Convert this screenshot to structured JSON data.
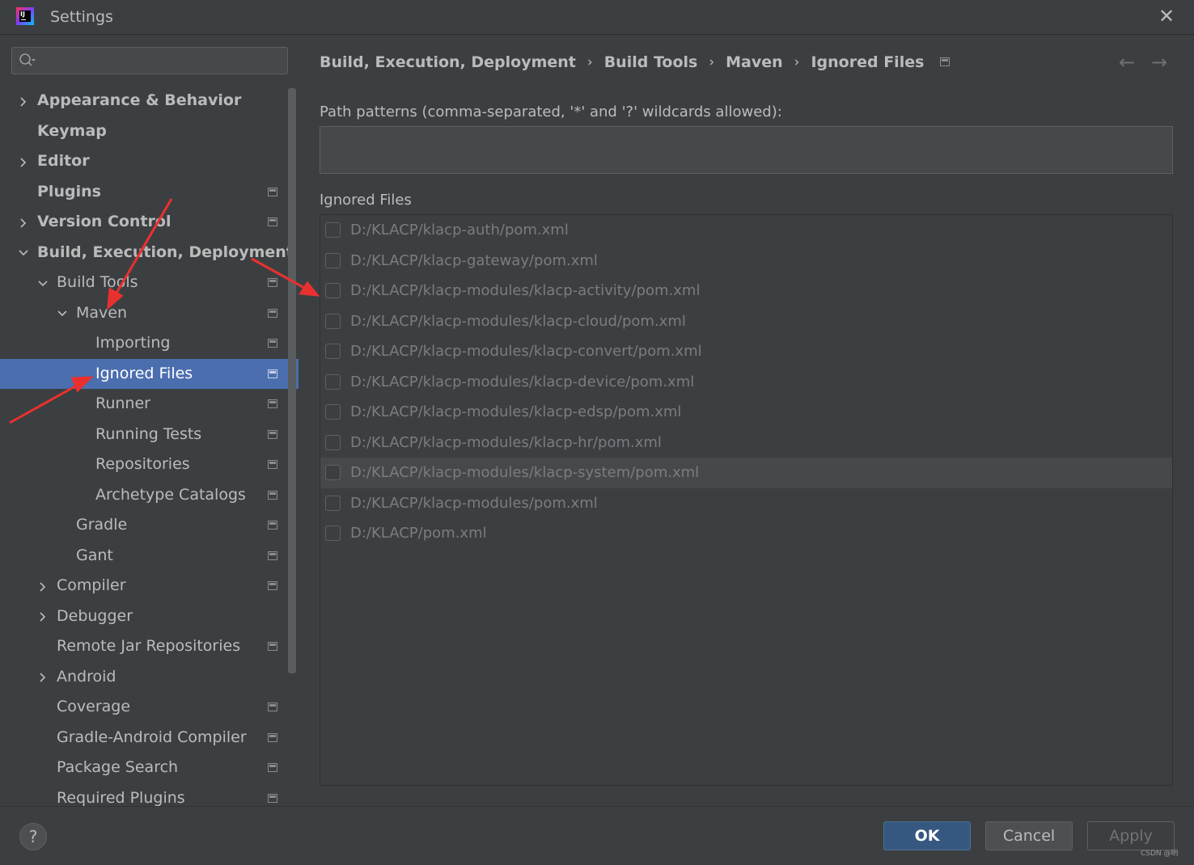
{
  "window": {
    "title": "Settings",
    "close_glyph": "✕",
    "app_icon": "intellij-logo",
    "app_icon_text": "IJ"
  },
  "search": {
    "placeholder": "",
    "value": "",
    "icon": "search-icon"
  },
  "tree": [
    {
      "label": "Appearance & Behavior",
      "level": 0,
      "bold": true,
      "expand": "collapsed",
      "project": false
    },
    {
      "label": "Keymap",
      "level": 0,
      "bold": true,
      "expand": "none",
      "project": false
    },
    {
      "label": "Editor",
      "level": 0,
      "bold": true,
      "expand": "collapsed",
      "project": false
    },
    {
      "label": "Plugins",
      "level": 0,
      "bold": true,
      "expand": "none",
      "project": true
    },
    {
      "label": "Version Control",
      "level": 0,
      "bold": true,
      "expand": "collapsed",
      "project": true
    },
    {
      "label": "Build, Execution, Deployment",
      "level": 0,
      "bold": true,
      "expand": "expanded",
      "project": false
    },
    {
      "label": "Build Tools",
      "level": 1,
      "bold": false,
      "expand": "expanded",
      "project": true
    },
    {
      "label": "Maven",
      "level": 2,
      "bold": false,
      "expand": "expanded",
      "project": true
    },
    {
      "label": "Importing",
      "level": 3,
      "bold": false,
      "expand": "none",
      "project": true
    },
    {
      "label": "Ignored Files",
      "level": 3,
      "bold": false,
      "expand": "none",
      "project": true,
      "selected": true
    },
    {
      "label": "Runner",
      "level": 3,
      "bold": false,
      "expand": "none",
      "project": true
    },
    {
      "label": "Running Tests",
      "level": 3,
      "bold": false,
      "expand": "none",
      "project": true
    },
    {
      "label": "Repositories",
      "level": 3,
      "bold": false,
      "expand": "none",
      "project": true
    },
    {
      "label": "Archetype Catalogs",
      "level": 3,
      "bold": false,
      "expand": "none",
      "project": true
    },
    {
      "label": "Gradle",
      "level": 2,
      "bold": false,
      "expand": "none",
      "project": true
    },
    {
      "label": "Gant",
      "level": 2,
      "bold": false,
      "expand": "none",
      "project": true
    },
    {
      "label": "Compiler",
      "level": 1,
      "bold": false,
      "expand": "collapsed",
      "project": true
    },
    {
      "label": "Debugger",
      "level": 1,
      "bold": false,
      "expand": "collapsed",
      "project": false
    },
    {
      "label": "Remote Jar Repositories",
      "level": 1,
      "bold": false,
      "expand": "none",
      "project": true
    },
    {
      "label": "Android",
      "level": 1,
      "bold": false,
      "expand": "collapsed",
      "project": false
    },
    {
      "label": "Coverage",
      "level": 1,
      "bold": false,
      "expand": "none",
      "project": true
    },
    {
      "label": "Gradle-Android Compiler",
      "level": 1,
      "bold": false,
      "expand": "none",
      "project": true
    },
    {
      "label": "Package Search",
      "level": 1,
      "bold": false,
      "expand": "none",
      "project": true
    },
    {
      "label": "Required Plugins",
      "level": 1,
      "bold": false,
      "expand": "none",
      "project": true
    }
  ],
  "breadcrumb": [
    "Build, Execution, Deployment",
    "Build Tools",
    "Maven",
    "Ignored Files"
  ],
  "breadcrumb_sep": "›",
  "nav": {
    "back": "←",
    "forward": "→"
  },
  "path_patterns": {
    "label": "Path patterns (comma-separated, '*' and '?' wildcards allowed):",
    "value": ""
  },
  "ignored_files": {
    "label": "Ignored Files",
    "items": [
      {
        "path": "D:/KLACP/klacp-auth/pom.xml",
        "checked": false
      },
      {
        "path": "D:/KLACP/klacp-gateway/pom.xml",
        "checked": false
      },
      {
        "path": "D:/KLACP/klacp-modules/klacp-activity/pom.xml",
        "checked": false
      },
      {
        "path": "D:/KLACP/klacp-modules/klacp-cloud/pom.xml",
        "checked": false
      },
      {
        "path": "D:/KLACP/klacp-modules/klacp-convert/pom.xml",
        "checked": false
      },
      {
        "path": "D:/KLACP/klacp-modules/klacp-device/pom.xml",
        "checked": false
      },
      {
        "path": "D:/KLACP/klacp-modules/klacp-edsp/pom.xml",
        "checked": false
      },
      {
        "path": "D:/KLACP/klacp-modules/klacp-hr/pom.xml",
        "checked": false
      },
      {
        "path": "D:/KLACP/klacp-modules/klacp-system/pom.xml",
        "checked": false,
        "hover": true
      },
      {
        "path": "D:/KLACP/klacp-modules/pom.xml",
        "checked": false
      },
      {
        "path": "D:/KLACP/pom.xml",
        "checked": false
      }
    ]
  },
  "buttons": {
    "help": "?",
    "ok": "OK",
    "cancel": "Cancel",
    "apply": "Apply"
  },
  "watermark": "CSDN @哟",
  "colors": {
    "selection": "#4b6eaf",
    "annotation": "#e8312f",
    "ok_button": "#365880"
  }
}
